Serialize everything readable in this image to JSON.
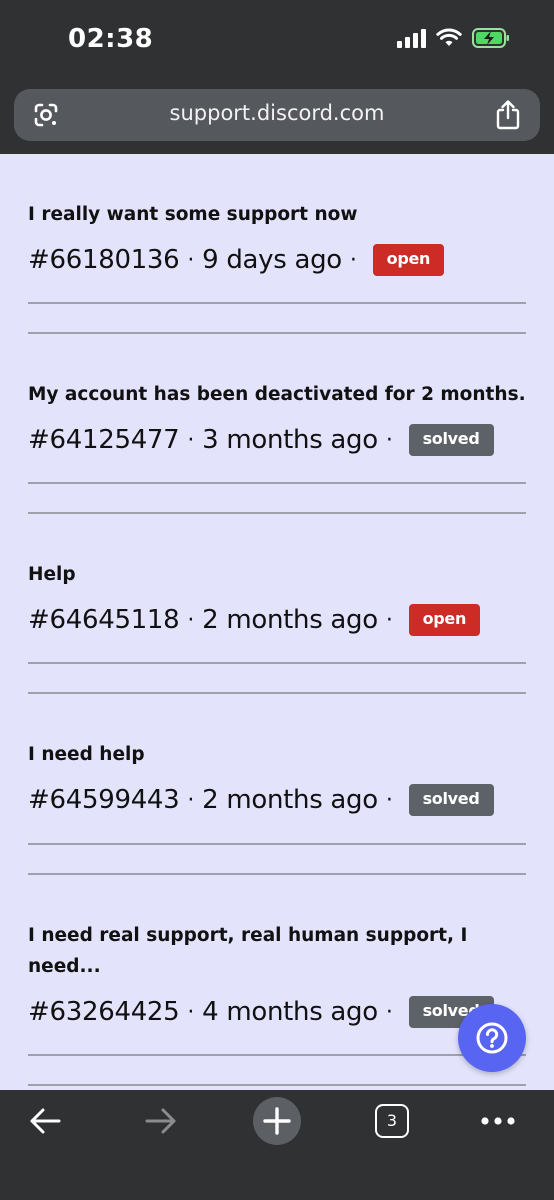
{
  "status_bar": {
    "time": "02:38"
  },
  "browser": {
    "url": "support.discord.com",
    "tab_count": "3"
  },
  "tickets": [
    {
      "title": "I really want some support now",
      "id": "#66180136",
      "age": "9 days ago",
      "status": "open"
    },
    {
      "title": "My account has been deactivated for 2 months.",
      "id": "#64125477",
      "age": "3 months ago",
      "status": "solved"
    },
    {
      "title": "Help",
      "id": "#64645118",
      "age": "2 months ago",
      "status": "open"
    },
    {
      "title": "I need help",
      "id": "#64599443",
      "age": "2 months ago",
      "status": "solved"
    },
    {
      "title": "I need real support, real human support, I need...",
      "id": "#63264425",
      "age": "4 months ago",
      "status": "solved"
    }
  ],
  "separator": "·",
  "colors": {
    "page_background": "#e3e3fc",
    "open_badge": "#cc2b26",
    "solved_badge": "#5d6268",
    "help_button": "#5865f2",
    "browser_chrome": "#2f3133"
  },
  "icons": {
    "url_left": "google-lens-icon",
    "url_right": "share-icon",
    "help": "question-mark-icon",
    "toolbar": [
      "back-arrow-icon",
      "forward-arrow-icon",
      "new-tab-plus-icon",
      "tab-switcher-icon",
      "more-dots-icon"
    ]
  }
}
